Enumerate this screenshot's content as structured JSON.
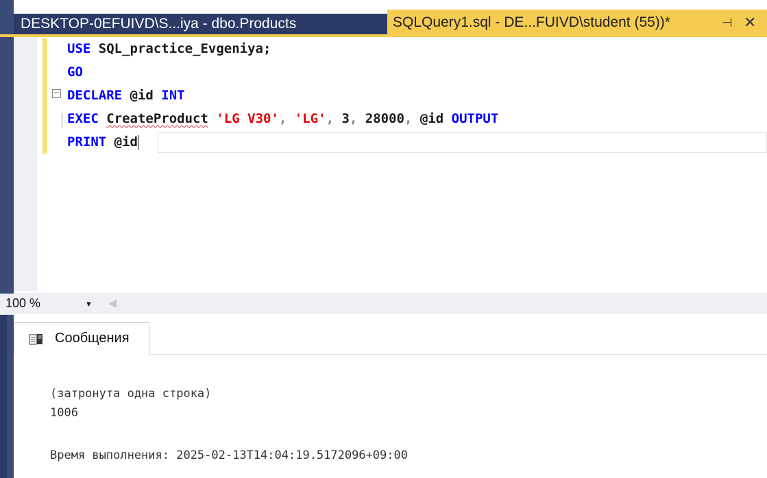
{
  "tabs": [
    {
      "label": "DESKTOP-0EFUIVD\\S...iya - dbo.Products",
      "active": false
    },
    {
      "label": "SQLQuery1.sql - DE...FUIVD\\student (55))*",
      "active": true
    }
  ],
  "tab_controls": {
    "pin": "⊣",
    "close": "✕"
  },
  "editor": {
    "lines": [
      {
        "keyword": "USE",
        "rest": " SQL_practice_Evgeniya;"
      },
      {
        "keyword": "GO"
      },
      {
        "keyword": "DECLARE",
        "var": " @id ",
        "type": "INT"
      },
      {
        "keyword": "EXEC",
        "proc": "CreateProduct",
        "args": [
          {
            "kind": "string",
            "text": "'LG V30'"
          },
          {
            "kind": "punct",
            "text": ", "
          },
          {
            "kind": "string",
            "text": "'LG'"
          },
          {
            "kind": "punct",
            "text": ", "
          },
          {
            "kind": "number",
            "text": "3"
          },
          {
            "kind": "punct",
            "text": ", "
          },
          {
            "kind": "number",
            "text": "28000"
          },
          {
            "kind": "punct",
            "text": ", "
          },
          {
            "kind": "var",
            "text": "@id"
          },
          {
            "kind": "keyword",
            "text": " OUTPUT"
          }
        ]
      },
      {
        "keyword": "PRINT",
        "var": " @id"
      }
    ],
    "collapse_glyph": "−"
  },
  "zoom": {
    "value": "100 %",
    "arrow": "▼",
    "scroll_left": "◀"
  },
  "results": {
    "tab_label": "Сообщения",
    "messages": [
      "(затронута одна строка)",
      "1006",
      "Время выполнения: 2025-02-13T14:04:19.5172096+09:00"
    ]
  },
  "colors": {
    "tab_active": "#f5cc51",
    "tab_inactive": "#2b3a67",
    "keyword": "#0000ff",
    "string": "#e60000"
  }
}
